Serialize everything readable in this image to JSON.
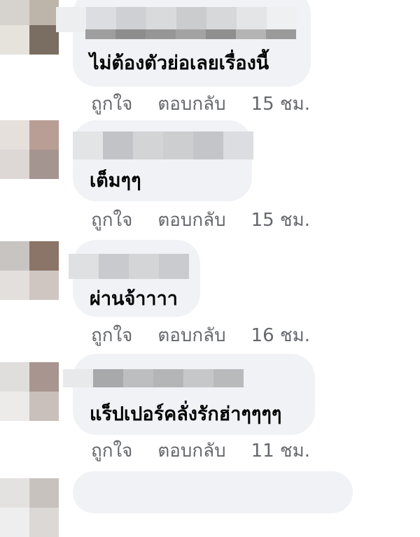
{
  "comments": [
    {
      "text": "ไม่ต้องตัวย่อเลยเรื่องนี้",
      "like_label": "ถูกใจ",
      "reply_label": "ตอบกลับ",
      "timestamp": "15 ชม."
    },
    {
      "text": "เต็มๆๆ",
      "like_label": "ถูกใจ",
      "reply_label": "ตอบกลับ",
      "timestamp": "15 ชม."
    },
    {
      "text": "ผ่านจ้าาาา",
      "like_label": "ถูกใจ",
      "reply_label": "ตอบกลับ",
      "timestamp": "16 ชม."
    },
    {
      "text": "แร็ปเปอร์คลั่งรักฮ่าๆๆๆๆ",
      "like_label": "ถูกใจ",
      "reply_label": "ตอบกลับ",
      "timestamp": "11 ชม."
    }
  ],
  "colors": {
    "bubble_bg": "#f0f2f5",
    "text": "#050505",
    "secondary_text": "#65676b"
  }
}
